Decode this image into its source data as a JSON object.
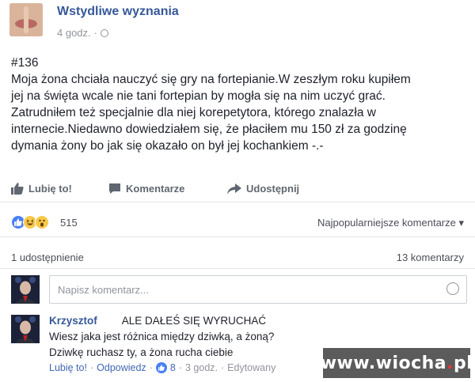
{
  "post": {
    "page_name": "Wstydliwe wyznania",
    "time": "4 godz.",
    "separator": "·",
    "number": "#136",
    "lines": [
      "Moja żona chciała nauczyć się gry na fortepianie.W zeszłym roku kupiłem",
      "jej na święta wcale nie tani fortepian by mogła się na nim uczyć grać.",
      "Zatrudniłem też specjalnie dla niej korepetytora, którego znalazła w",
      "internecie.Niedawno dowiedziałem się, że płaciłem mu 150 zł za godzinę",
      "dymania żony bo jak się okazało on był jej kochankiem -.-"
    ]
  },
  "actions": {
    "like": "Lubię to!",
    "comment": "Komentarze",
    "share": "Udostępnij"
  },
  "reactions": {
    "count": "515",
    "types": [
      "like-icon",
      "haha-icon",
      "wow-icon"
    ],
    "sort_label": "Najpopularniejsze komentarze ▾"
  },
  "stats": {
    "shares": "1 udostępnienie",
    "comments": "13 komentarzy"
  },
  "comment_box": {
    "placeholder": "Napisz komentarz..."
  },
  "comment": {
    "author": "Krzysztof",
    "shout": "ALE DAŁEŚ SIĘ WYRUCHAĆ",
    "line2": "Wiesz jaka jest różnica między dziwką, a żoną?",
    "line3": "Dziwkę ruchasz ty, a żona rucha ciebie",
    "like": "Lubię to!",
    "dot1": "·",
    "reply": "Odpowiedz",
    "dot2": "·",
    "likes": "8",
    "dot3": "·",
    "time": "3 godz.",
    "dot4": "·",
    "edited": "Edytowany"
  },
  "watermark": {
    "left": "www.",
    "brand": "wiocha",
    "dot": ".",
    "tld": "pl"
  },
  "colors": {
    "link": "#365899",
    "muted": "#90949c",
    "like_blue": "#4a7ff5",
    "watermark_bg": "#5b5b5b"
  }
}
